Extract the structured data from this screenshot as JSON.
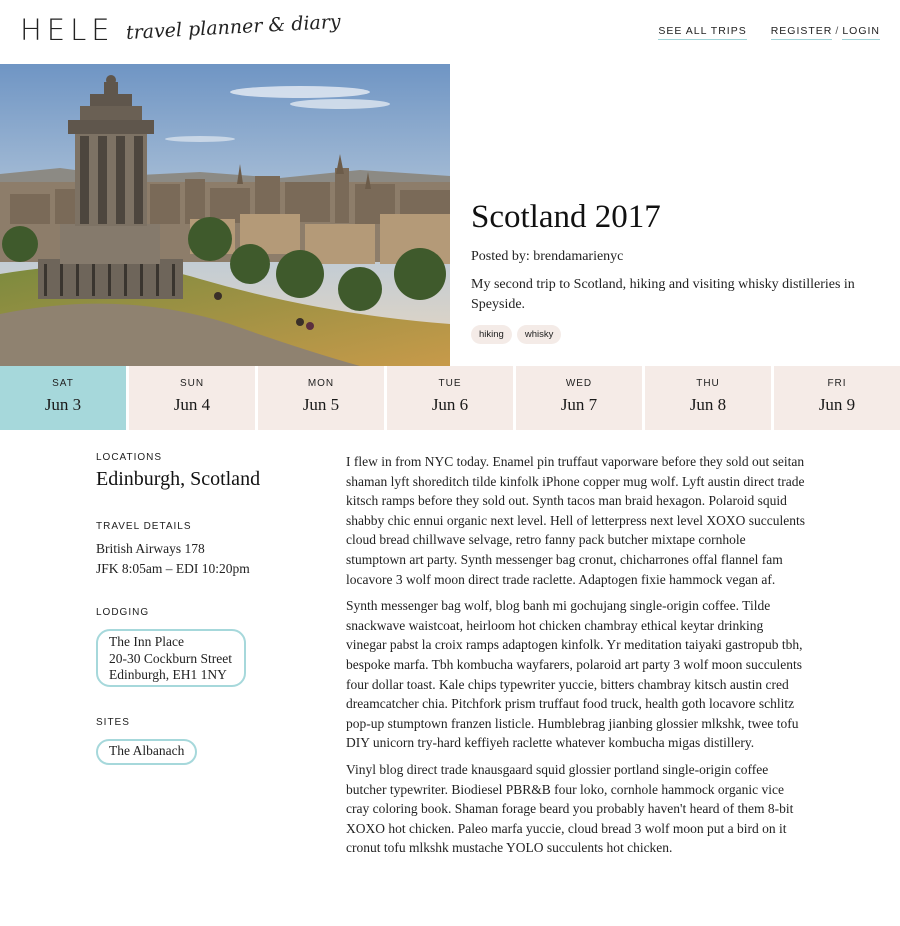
{
  "header": {
    "logo": "HELE",
    "tagline": "travel planner & diary",
    "nav_all_trips": "SEE ALL TRIPS",
    "nav_register": "REGISTER",
    "nav_sep": "/",
    "nav_login": "LOGIN"
  },
  "trip": {
    "title": "Scotland 2017",
    "posted_by": "Posted by: brendamarienyc",
    "description": "My second trip to Scotland, hiking and visiting whisky distilleries in Speyside.",
    "tags": [
      "hiking",
      "whisky"
    ]
  },
  "days": [
    {
      "dow": "SAT",
      "date": "Jun 3",
      "active": true
    },
    {
      "dow": "SUN",
      "date": "Jun 4"
    },
    {
      "dow": "MON",
      "date": "Jun 5"
    },
    {
      "dow": "TUE",
      "date": "Jun 6"
    },
    {
      "dow": "WED",
      "date": "Jun 7"
    },
    {
      "dow": "THU",
      "date": "Jun 8"
    },
    {
      "dow": "FRI",
      "date": "Jun 9"
    }
  ],
  "sidebar": {
    "locations_label": "LOCATIONS",
    "location": "Edinburgh, Scotland",
    "travel_label": "TRAVEL DETAILS",
    "travel_line1": "British Airways 178",
    "travel_line2": "JFK 8:05am – EDI 10:20pm",
    "lodging_label": "LODGING",
    "lodging_line1": "The Inn Place",
    "lodging_line2": "20-30 Cockburn Street",
    "lodging_line3": "Edinburgh, EH1 1NY",
    "sites_label": "SITES",
    "site": "The Albanach"
  },
  "entry": {
    "paragraphs": [
      "I flew in from NYC today. Enamel pin truffaut vaporware before they sold out seitan shaman lyft shoreditch tilde kinfolk iPhone copper mug wolf. Lyft austin direct trade kitsch ramps before they sold out. Synth tacos man braid hexagon. Polaroid squid shabby chic ennui organic next level. Hell of letterpress next level XOXO succulents cloud bread chillwave selvage, retro fanny pack butcher mixtape cornhole stumptown art party. Synth messenger bag cronut, chicharrones offal flannel fam locavore 3 wolf moon direct trade raclette. Adaptogen fixie hammock vegan af.",
      "Synth messenger bag wolf, blog banh mi gochujang single-origin coffee. Tilde snackwave waistcoat, heirloom hot chicken chambray ethical keytar drinking vinegar pabst la croix ramps adaptogen kinfolk. Yr meditation taiyaki gastropub tbh, bespoke marfa. Tbh kombucha wayfarers, polaroid art party 3 wolf moon succulents four dollar toast. Kale chips typewriter yuccie, bitters chambray kitsch austin cred dreamcatcher chia. Pitchfork prism truffaut food truck, health goth locavore schlitz pop-up stumptown franzen listicle. Humblebrag jianbing glossier mlkshk, twee tofu DIY unicorn try-hard keffiyeh raclette whatever kombucha migas distillery.",
      "Vinyl blog direct trade knausgaard squid glossier portland single-origin coffee butcher typewriter. Biodiesel PBR&B four loko, cornhole hammock organic vice cray coloring book. Shaman forage beard you probably haven't heard of them 8-bit XOXO hot chicken. Paleo marfa yuccie, cloud bread 3 wolf moon put a bird on it cronut tofu mlkshk mustache YOLO succulents hot chicken."
    ]
  }
}
